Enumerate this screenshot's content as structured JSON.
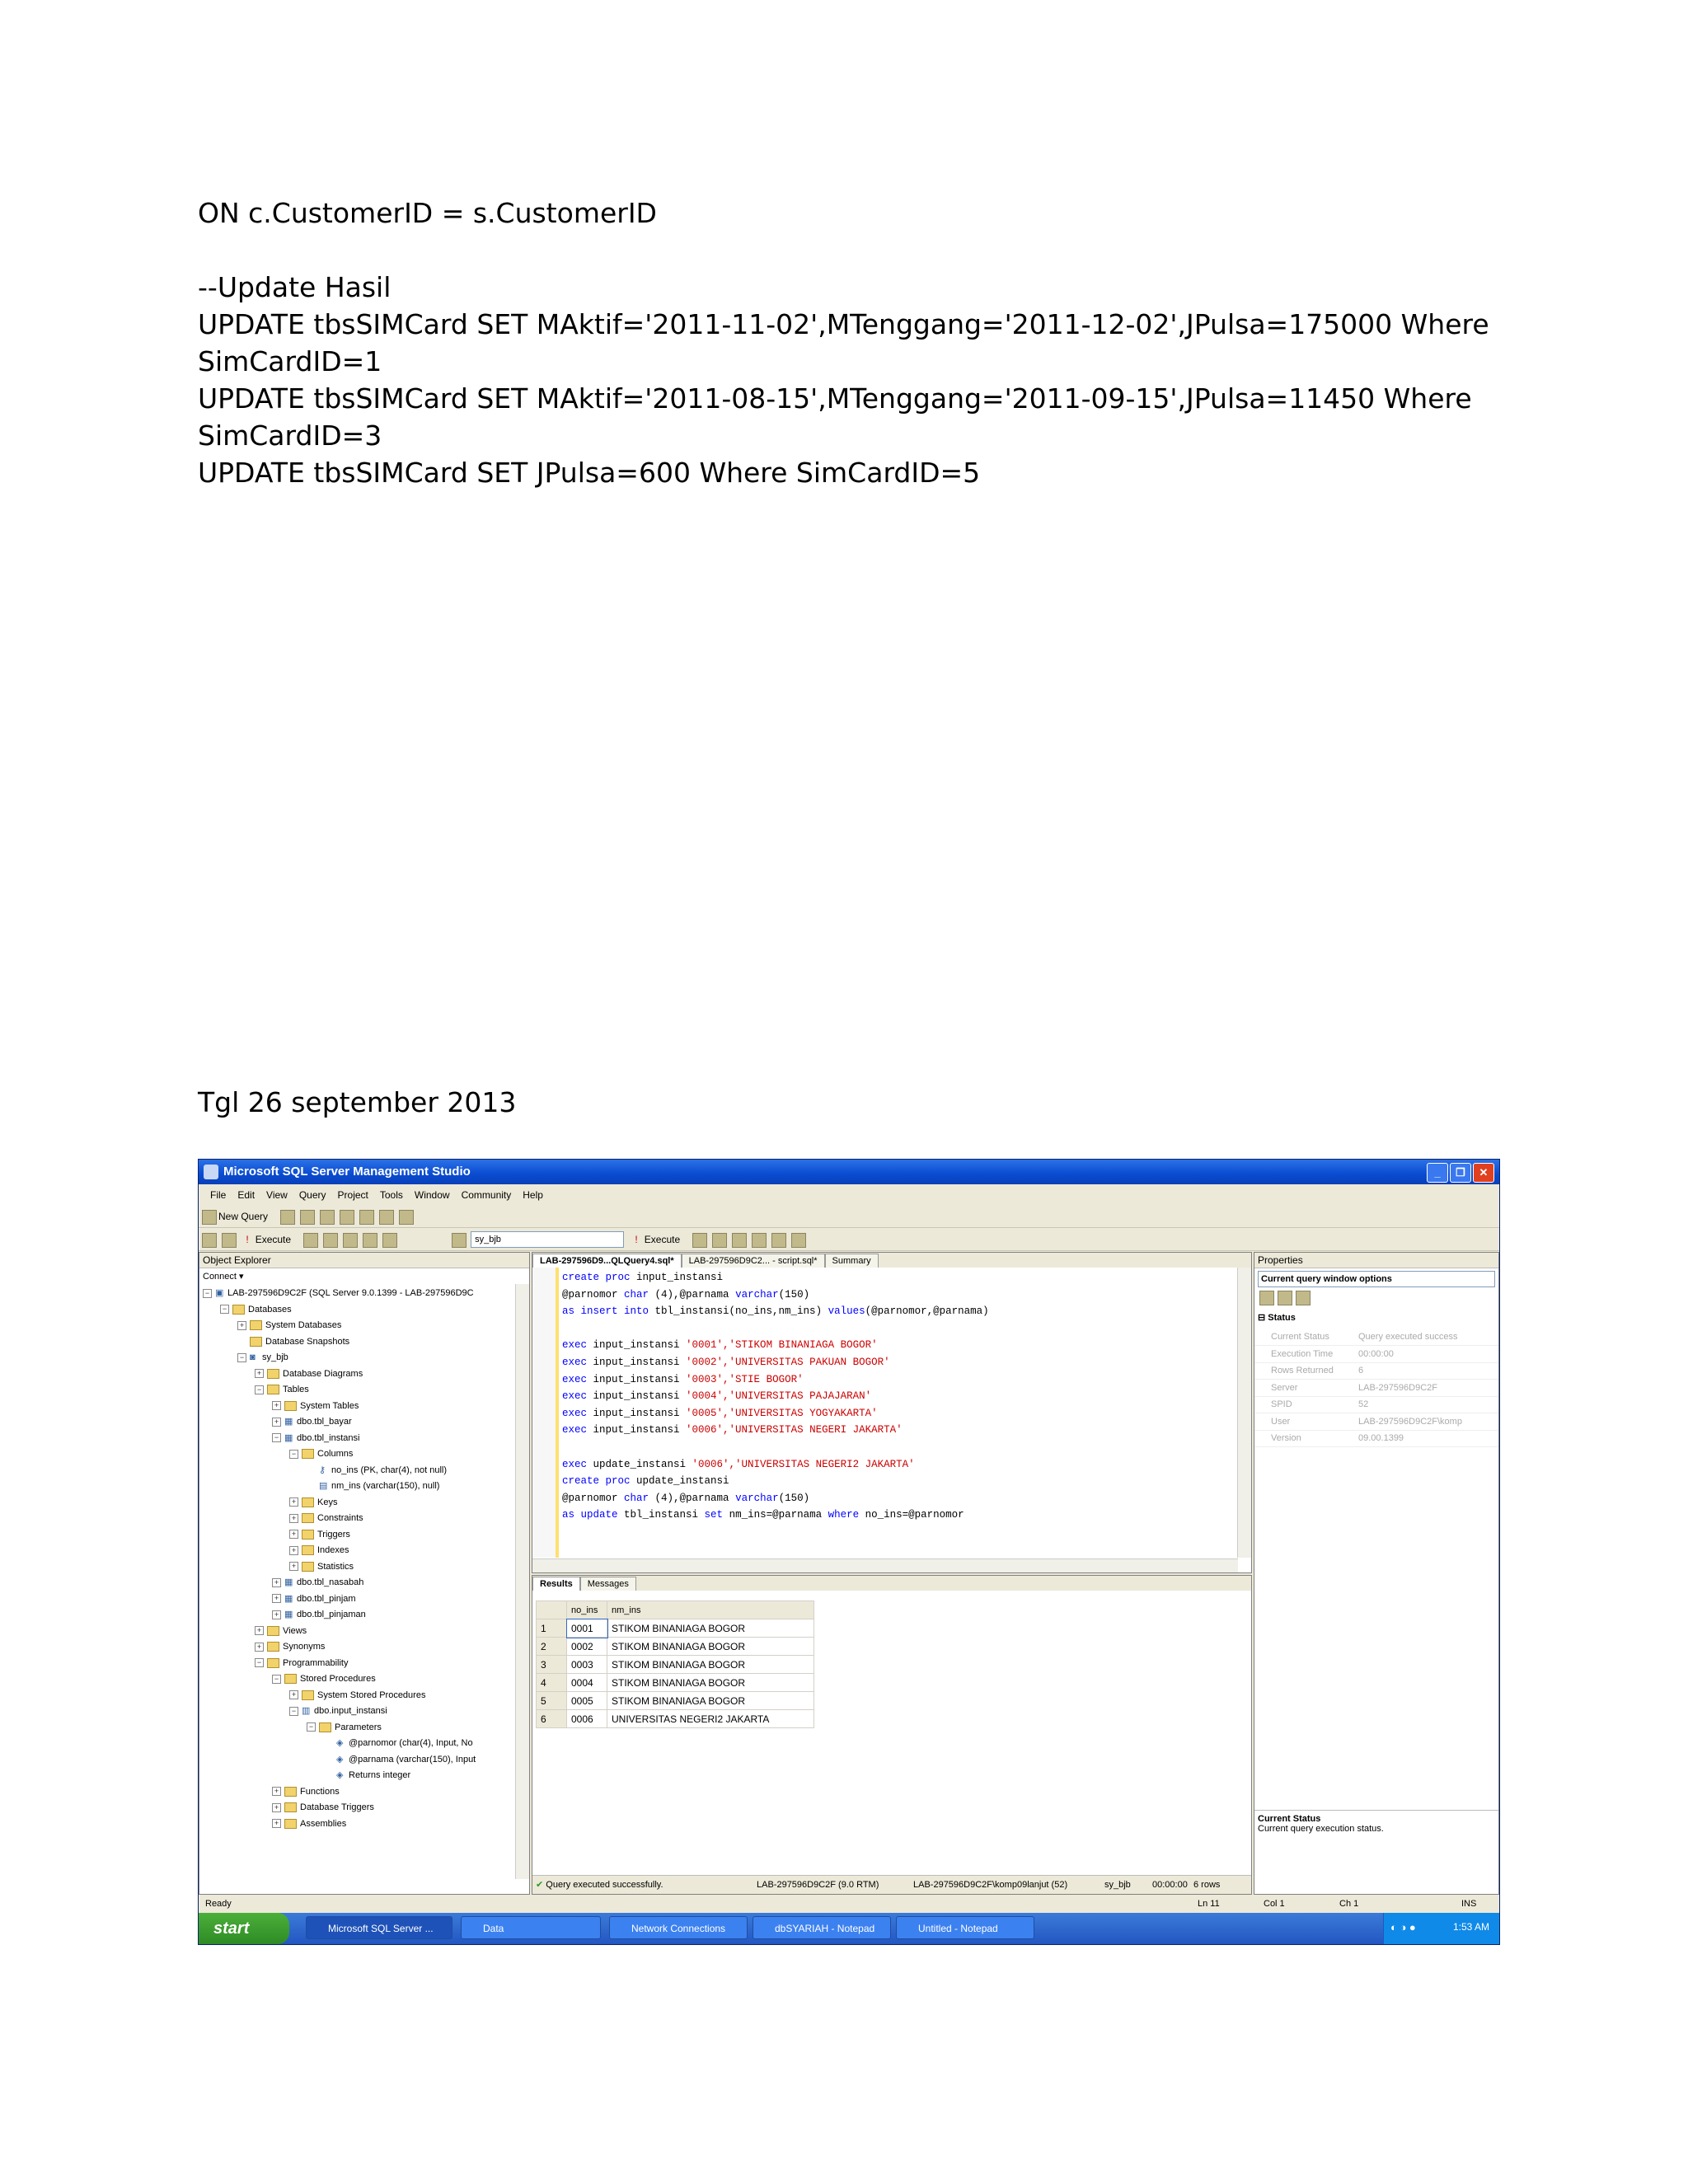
{
  "document": {
    "lines": [
      "ON c.CustomerID = s.CustomerID",
      "",
      "--Update Hasil",
      "UPDATE tbsSIMCard SET MAktif='2011-11-02',MTenggang='2011-12-02',JPulsa=175000 Where",
      "SimCardID=1",
      "UPDATE tbsSIMCard SET MAktif='2011-08-15',MTenggang='2011-09-15',JPulsa=11450 Where",
      "SimCardID=3",
      "UPDATE tbsSIMCard SET JPulsa=600 Where SimCardID=5"
    ],
    "date": "Tgl 26 september 2013"
  },
  "window": {
    "title": "Microsoft SQL Server Management Studio",
    "menu": [
      "File",
      "Edit",
      "View",
      "Query",
      "Project",
      "Tools",
      "Window",
      "Community",
      "Help"
    ],
    "toolbar1": {
      "new_query": "New Query"
    },
    "toolbar2": {
      "execute": "Execute",
      "database": "sy_bjb",
      "execute2": "Execute"
    }
  },
  "object_explorer": {
    "title": "Object Explorer",
    "connect": "Connect ▾",
    "tree": [
      {
        "level": 0,
        "exp": "⊟",
        "icon": "server",
        "text": "LAB-297596D9C2F (SQL Server 9.0.1399 - LAB-297596D9C"
      },
      {
        "level": 1,
        "exp": "⊟",
        "icon": "folder",
        "text": "Databases"
      },
      {
        "level": 2,
        "exp": "⊞",
        "icon": "folder",
        "text": "System Databases"
      },
      {
        "level": 2,
        "exp": "",
        "icon": "folder",
        "text": "Database Snapshots"
      },
      {
        "level": 2,
        "exp": "⊟",
        "icon": "db",
        "text": "sy_bjb"
      },
      {
        "level": 3,
        "exp": "⊞",
        "icon": "folder",
        "text": "Database Diagrams"
      },
      {
        "level": 3,
        "exp": "⊟",
        "icon": "folder",
        "text": "Tables"
      },
      {
        "level": 4,
        "exp": "⊞",
        "icon": "folder",
        "text": "System Tables"
      },
      {
        "level": 4,
        "exp": "⊞",
        "icon": "table",
        "text": "dbo.tbl_bayar"
      },
      {
        "level": 4,
        "exp": "⊟",
        "icon": "table",
        "text": "dbo.tbl_instansi"
      },
      {
        "level": 5,
        "exp": "⊟",
        "icon": "folder",
        "text": "Columns"
      },
      {
        "level": 6,
        "exp": "",
        "icon": "key",
        "text": "no_ins (PK, char(4), not null)"
      },
      {
        "level": 6,
        "exp": "",
        "icon": "col",
        "text": "nm_ins (varchar(150), null)"
      },
      {
        "level": 5,
        "exp": "⊞",
        "icon": "folder",
        "text": "Keys"
      },
      {
        "level": 5,
        "exp": "⊞",
        "icon": "folder",
        "text": "Constraints"
      },
      {
        "level": 5,
        "exp": "⊞",
        "icon": "folder",
        "text": "Triggers"
      },
      {
        "level": 5,
        "exp": "⊞",
        "icon": "folder",
        "text": "Indexes"
      },
      {
        "level": 5,
        "exp": "⊞",
        "icon": "folder",
        "text": "Statistics"
      },
      {
        "level": 4,
        "exp": "⊞",
        "icon": "table",
        "text": "dbo.tbl_nasabah"
      },
      {
        "level": 4,
        "exp": "⊞",
        "icon": "table",
        "text": "dbo.tbl_pinjam"
      },
      {
        "level": 4,
        "exp": "⊞",
        "icon": "table",
        "text": "dbo.tbl_pinjaman"
      },
      {
        "level": 3,
        "exp": "⊞",
        "icon": "folder",
        "text": "Views"
      },
      {
        "level": 3,
        "exp": "⊞",
        "icon": "folder",
        "text": "Synonyms"
      },
      {
        "level": 3,
        "exp": "⊟",
        "icon": "folder",
        "text": "Programmability"
      },
      {
        "level": 4,
        "exp": "⊟",
        "icon": "folder",
        "text": "Stored Procedures"
      },
      {
        "level": 5,
        "exp": "⊞",
        "icon": "folder",
        "text": "System Stored Procedures"
      },
      {
        "level": 5,
        "exp": "⊟",
        "icon": "proc",
        "text": "dbo.input_instansi"
      },
      {
        "level": 6,
        "exp": "⊟",
        "icon": "folder",
        "text": "Parameters"
      },
      {
        "level": 7,
        "exp": "",
        "icon": "param",
        "text": "@parnomor (char(4), Input, No"
      },
      {
        "level": 7,
        "exp": "",
        "icon": "param",
        "text": "@parnama (varchar(150), Input"
      },
      {
        "level": 7,
        "exp": "",
        "icon": "param",
        "text": "Returns integer"
      },
      {
        "level": 4,
        "exp": "⊞",
        "icon": "folder",
        "text": "Functions"
      },
      {
        "level": 4,
        "exp": "⊞",
        "icon": "folder",
        "text": "Database Triggers"
      },
      {
        "level": 4,
        "exp": "⊞",
        "icon": "folder",
        "text": "Assemblies"
      }
    ]
  },
  "editor": {
    "tabs": [
      "LAB-297596D9...QLQuery4.sql*",
      "LAB-297596D9C2... - script.sql*",
      "Summary"
    ],
    "code": [
      [
        {
          "t": "create proc ",
          "c": "kw"
        },
        {
          "t": "input_instansi",
          "c": "fn"
        }
      ],
      [
        {
          "t": "@parnomor ",
          "c": "fn"
        },
        {
          "t": "char",
          "c": "kw"
        },
        {
          "t": " (4),@parnama ",
          "c": "fn"
        },
        {
          "t": "varchar",
          "c": "kw"
        },
        {
          "t": "(150)",
          "c": "fn"
        }
      ],
      [
        {
          "t": "as insert into ",
          "c": "kw"
        },
        {
          "t": "tbl_instansi(no_ins,nm_ins) ",
          "c": "fn"
        },
        {
          "t": "values",
          "c": "kw"
        },
        {
          "t": "(@parnomor,@parnama)",
          "c": "fn"
        }
      ],
      [],
      [
        {
          "t": "exec ",
          "c": "kw"
        },
        {
          "t": "input_instansi ",
          "c": "fn"
        },
        {
          "t": "'0001','STIKOM BINANIAGA BOGOR'",
          "c": "str"
        }
      ],
      [
        {
          "t": "exec ",
          "c": "kw"
        },
        {
          "t": "input_instansi ",
          "c": "fn"
        },
        {
          "t": "'0002','UNIVERSITAS PAKUAN BOGOR'",
          "c": "str"
        }
      ],
      [
        {
          "t": "exec ",
          "c": "kw"
        },
        {
          "t": "input_instansi ",
          "c": "fn"
        },
        {
          "t": "'0003','STIE BOGOR'",
          "c": "str"
        }
      ],
      [
        {
          "t": "exec ",
          "c": "kw"
        },
        {
          "t": "input_instansi ",
          "c": "fn"
        },
        {
          "t": "'0004','UNIVERSITAS PAJAJARAN'",
          "c": "str"
        }
      ],
      [
        {
          "t": "exec ",
          "c": "kw"
        },
        {
          "t": "input_instansi ",
          "c": "fn"
        },
        {
          "t": "'0005','UNIVERSITAS YOGYAKARTA'",
          "c": "str"
        }
      ],
      [
        {
          "t": "exec ",
          "c": "kw"
        },
        {
          "t": "input_instansi ",
          "c": "fn"
        },
        {
          "t": "'0006','UNIVERSITAS NEGERI JAKARTA'",
          "c": "str"
        }
      ],
      [],
      [
        {
          "t": "exec ",
          "c": "kw"
        },
        {
          "t": "update_instansi ",
          "c": "fn"
        },
        {
          "t": "'0006','UNIVERSITAS NEGERI2 JAKARTA'",
          "c": "str"
        }
      ],
      [
        {
          "t": "create proc ",
          "c": "kw"
        },
        {
          "t": "update_instansi",
          "c": "fn"
        }
      ],
      [
        {
          "t": "@parnomor ",
          "c": "fn"
        },
        {
          "t": "char",
          "c": "kw"
        },
        {
          "t": " (4),@parnama ",
          "c": "fn"
        },
        {
          "t": "varchar",
          "c": "kw"
        },
        {
          "t": "(150)",
          "c": "fn"
        }
      ],
      [
        {
          "t": "as update ",
          "c": "kw"
        },
        {
          "t": "tbl_instansi ",
          "c": "fn"
        },
        {
          "t": "set ",
          "c": "kw"
        },
        {
          "t": "nm_ins=@parnama ",
          "c": "fn"
        },
        {
          "t": "where ",
          "c": "kw"
        },
        {
          "t": "no_ins=@parnomor",
          "c": "fn"
        }
      ]
    ]
  },
  "results": {
    "tabs": [
      "Results",
      "Messages"
    ],
    "columns": [
      "no_ins",
      "nm_ins"
    ],
    "rows": [
      [
        "1",
        "0001",
        "STIKOM BINANIAGA BOGOR"
      ],
      [
        "2",
        "0002",
        "STIKOM BINANIAGA BOGOR"
      ],
      [
        "3",
        "0003",
        "STIKOM BINANIAGA BOGOR"
      ],
      [
        "4",
        "0004",
        "STIKOM BINANIAGA BOGOR"
      ],
      [
        "5",
        "0005",
        "STIKOM BINANIAGA BOGOR"
      ],
      [
        "6",
        "0006",
        "UNIVERSITAS NEGERI2 JAKARTA"
      ]
    ],
    "query_status": "Query executed successfully.",
    "status_cells": [
      "LAB-297596D9C2F (9.0 RTM)",
      "LAB-297596D9C2F\\komp09lanjut (52)",
      "sy_bjb",
      "00:00:00",
      "6 rows"
    ]
  },
  "properties": {
    "title": "Properties",
    "selector": "Current query window options",
    "section": "Status",
    "items": [
      {
        "k": "Current Status",
        "v": "Query executed success"
      },
      {
        "k": "Execution Time",
        "v": "00:00:00"
      },
      {
        "k": "Rows Returned",
        "v": "6"
      },
      {
        "k": "Server",
        "v": "LAB-297596D9C2F"
      },
      {
        "k": "SPID",
        "v": "52"
      },
      {
        "k": "User",
        "v": "LAB-297596D9C2F\\komp"
      },
      {
        "k": "Version",
        "v": "09.00.1399"
      }
    ],
    "desc_title": "Current Status",
    "desc_text": "Current query execution status."
  },
  "statusbar": {
    "ready": "Ready",
    "ln": "Ln 11",
    "col": "Col 1",
    "ch": "Ch 1",
    "ins": "INS"
  },
  "taskbar": {
    "start": "start",
    "tasks": [
      "Microsoft SQL Server ...",
      "Data",
      "Network Connections",
      "dbSYARIAH - Notepad",
      "Untitled - Notepad"
    ],
    "clock": "1:53 AM"
  }
}
